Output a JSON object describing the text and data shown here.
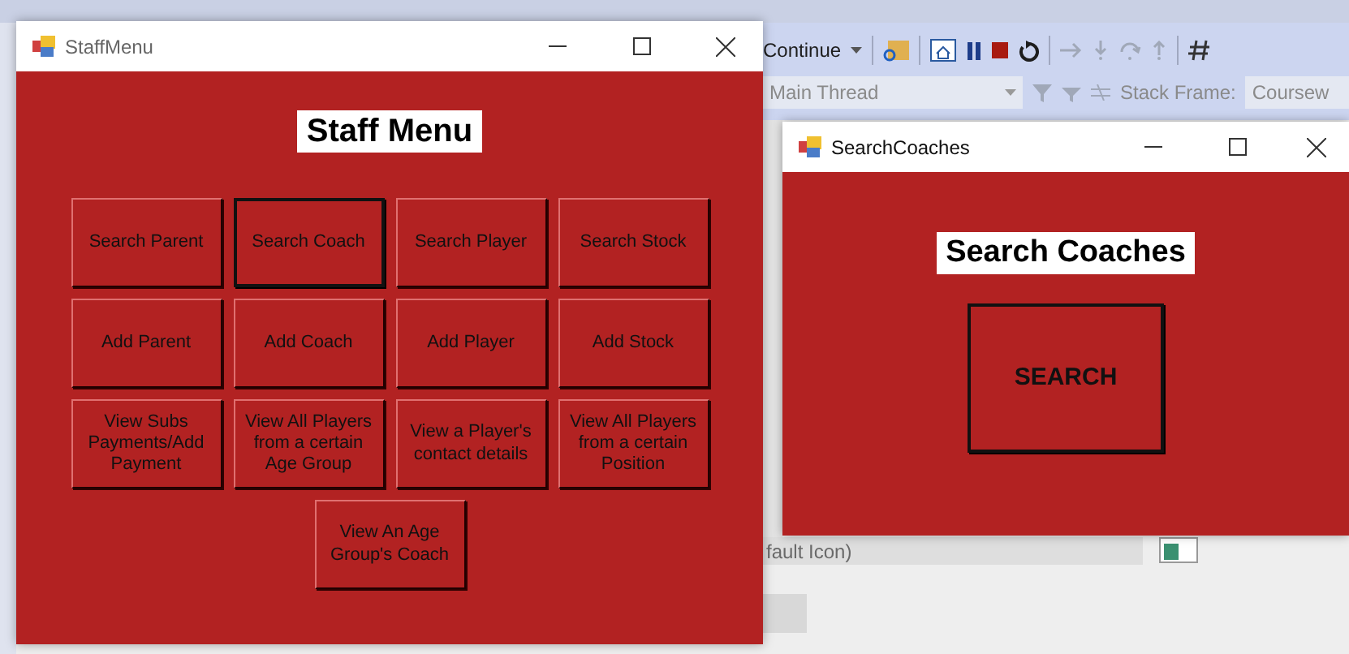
{
  "background": {
    "toolbar": {
      "continue_label": "Continue",
      "thread_dropdown": "Main Thread",
      "stack_frame_label": "Stack Frame:",
      "stack_frame_value": "Coursew"
    },
    "icon_dropdown": "fault Icon)"
  },
  "windows": [
    {
      "title": "StaffMenu",
      "kind": "menu",
      "heading": "Staff Menu",
      "buttons": [
        {
          "label": "Search Parent",
          "focused": false
        },
        {
          "label": "Search Coach",
          "focused": true
        },
        {
          "label": "Search Player",
          "focused": false
        },
        {
          "label": "Search Stock",
          "focused": false
        },
        {
          "label": "Add Parent",
          "focused": false
        },
        {
          "label": "Add Coach",
          "focused": false
        },
        {
          "label": "Add Player",
          "focused": false
        },
        {
          "label": "Add Stock",
          "focused": false
        },
        {
          "label": "View Subs Payments/Add Payment",
          "focused": false
        },
        {
          "label": "View All Players from a certain Age Group",
          "focused": false
        },
        {
          "label": "View a Player's contact details",
          "focused": false
        },
        {
          "label": "View All Players from a certain Position",
          "focused": false
        },
        {
          "label": "View An Age Group's Coach",
          "focused": false
        }
      ]
    },
    {
      "title": "SearchCoaches",
      "kind": "search",
      "heading": "Search Coaches",
      "buttons": [
        {
          "label": "SEARCH",
          "focused": true
        }
      ]
    }
  ]
}
